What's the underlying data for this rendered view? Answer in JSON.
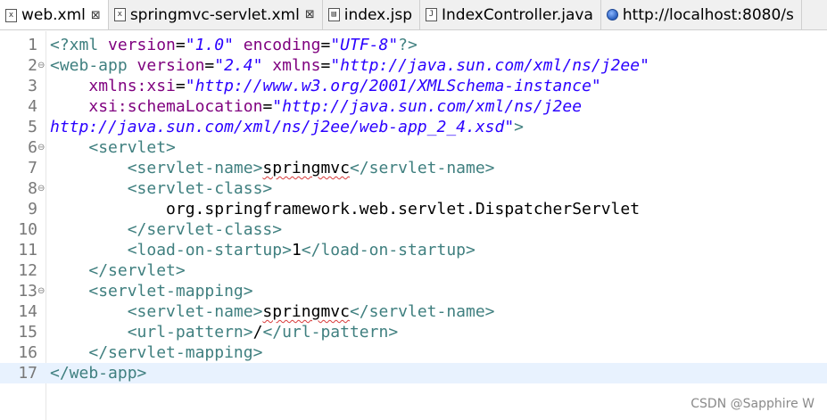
{
  "tabs": [
    {
      "label": "web.xml",
      "icon": "xml-file-icon",
      "active": true,
      "closable": true
    },
    {
      "label": "springmvc-servlet.xml",
      "icon": "xml-file-icon",
      "active": false,
      "closable": true
    },
    {
      "label": "index.jsp",
      "icon": "jsp-file-icon",
      "active": false,
      "closable": false
    },
    {
      "label": "IndexController.java",
      "icon": "java-file-icon",
      "active": false,
      "closable": false
    },
    {
      "label": "http://localhost:8080/s",
      "icon": "globe-icon",
      "active": false,
      "closable": false
    }
  ],
  "close_glyph": "⊠",
  "code": {
    "line_numbers": [
      "1",
      "2",
      "3",
      "4",
      "5",
      "6",
      "7",
      "8",
      "9",
      "10",
      "11",
      "12",
      "13",
      "14",
      "15",
      "16",
      "17"
    ],
    "fold_glyph": "⊖",
    "lines": [
      [
        "<?xml ",
        "version",
        "=",
        "\"1.0\"",
        " encoding",
        "=",
        "\"UTF-8\"",
        "?>"
      ],
      [
        "<web-app ",
        "version",
        "=",
        "\"2.4\"",
        " xmlns",
        "=",
        "\"http://java.sun.com/xml/ns/j2ee\""
      ],
      [
        "    ",
        "xmlns:xsi",
        "=",
        "\"http://www.w3.org/2001/XMLSchema-instance\""
      ],
      [
        "    ",
        "xsi:schemaLocation",
        "=",
        "\"http://java.sun.com/xml/ns/j2ee"
      ],
      [
        "http://java.sun.com/xml/ns/j2ee/web-app_2_4.xsd\"",
        ">"
      ],
      [
        "    ",
        "<servlet>"
      ],
      [
        "        ",
        "<servlet-name>",
        "springmvc",
        "</servlet-name>"
      ],
      [
        "        ",
        "<servlet-class>"
      ],
      [
        "            ",
        "org.springframework.web.servlet.DispatcherServlet"
      ],
      [
        "        ",
        "</servlet-class>"
      ],
      [
        "        ",
        "<load-on-startup>",
        "1",
        "</load-on-startup>"
      ],
      [
        "    ",
        "</servlet>"
      ],
      [
        "    ",
        "<servlet-mapping>"
      ],
      [
        "        ",
        "<servlet-name>",
        "springmvc",
        "</servlet-name>"
      ],
      [
        "        ",
        "<url-pattern>",
        "/",
        "</url-pattern>"
      ],
      [
        "    ",
        "</servlet-mapping>"
      ],
      [
        "",
        "</web-app>"
      ]
    ]
  },
  "watermark": "CSDN @Sapphire W"
}
